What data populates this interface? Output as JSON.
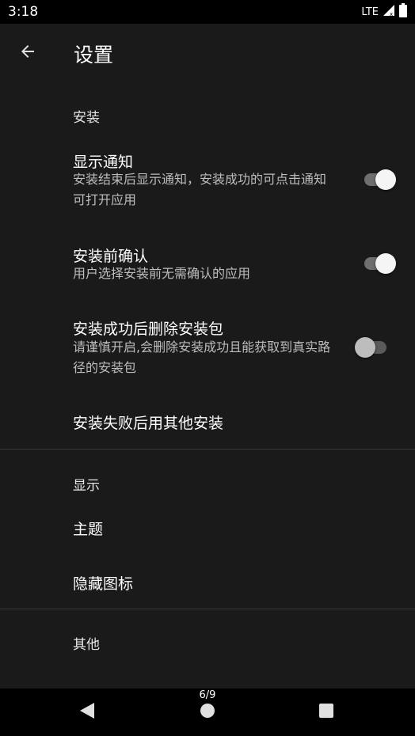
{
  "status_bar": {
    "time": "3:18",
    "network": "LTE",
    "icons": [
      "signal-icon",
      "battery-icon"
    ]
  },
  "app_bar": {
    "title": "设置",
    "back_icon": "arrow-left-icon"
  },
  "sections": {
    "install": {
      "header": "安装",
      "show_notification": {
        "title": "显示通知",
        "summary": "安装结束后显示通知，安装成功的可点击通知可打开应用",
        "enabled": true
      },
      "confirm_before_install": {
        "title": "安装前确认",
        "summary": "用户选择安装前无需确认的应用",
        "enabled": true
      },
      "delete_package_after_success": {
        "title": "安装成功后删除安装包",
        "summary": "请谨慎开启,会删除安装成功且能获取到真实路径的安装包",
        "enabled": false
      },
      "fallback_installer": {
        "title": "安装失败后用其他安装"
      }
    },
    "display": {
      "header": "显示",
      "theme": {
        "title": "主题"
      },
      "hide_icon": {
        "title": "隐藏图标"
      }
    },
    "other": {
      "header": "其他"
    }
  },
  "nav_bar": {
    "page_indicator": "6/9",
    "buttons": [
      "back-triangle-icon",
      "home-circle-icon",
      "recents-square-icon"
    ]
  },
  "colors": {
    "background": "#1a1a1a",
    "status_bar": "#000000",
    "text_primary": "#ffffff",
    "text_secondary": "#bdbdbd",
    "divider": "#3a3a3a"
  }
}
